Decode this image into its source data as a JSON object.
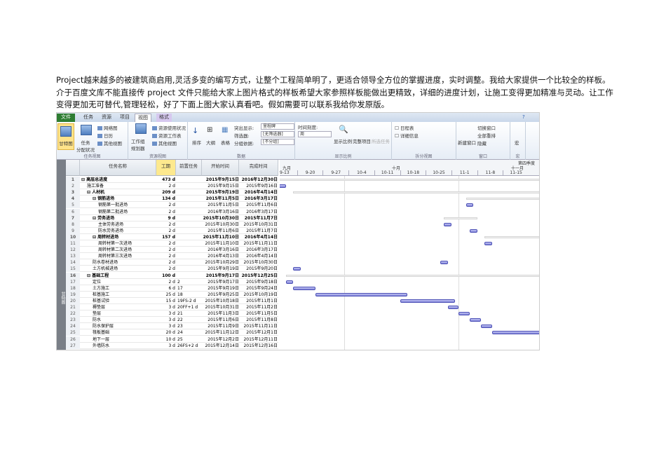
{
  "intro": "Project越来越多的被建筑商启用,灵活多变的编写方式，让整个工程简单明了，更适合领导全方位的掌握进度，实时调整。我给大家提供一个比较全的样板。介于百度文库不能直接传 project 文件只能给大家上图片格式的样板希望大家参照样板能做出更精致，详细的进度计划，让施工变得更加精准与灵动。让工作变得更加无可替代,管理轻松，好了下面上图大家认真看吧。假如需要可以联系我给你发原版。",
  "tabs": [
    "文件",
    "任务",
    "资源",
    "项目",
    "视图",
    "格式"
  ],
  "ribbon": {
    "task_view": {
      "gantt": "甘特图",
      "assign": "任务",
      "assign2": "分配状况",
      "network": "网络图",
      "calendar": "日历",
      "other": "其他视图",
      "label": "任务视图"
    },
    "res_view": {
      "planner": "工作组",
      "planner2": "规划器",
      "usage": "资源使用状况",
      "sheet": "资源工作表",
      "other": "其他视图",
      "label": "资源视图"
    },
    "data": {
      "sort": "排序",
      "outline": "大纲",
      "tables": "表格",
      "highlight": "突出显示:",
      "highlight_val": "里程碑",
      "filter": "筛选器:",
      "filter_val": "[无筛选器]",
      "group": "分组依据:",
      "group_val": "[不分组]",
      "label": "数据"
    },
    "zoom": {
      "timescale": "时间刻度:",
      "timescale_val": "周",
      "zoom": "显示比例",
      "entire": "完整项目",
      "selected": "所选任务",
      "label": "显示比例"
    },
    "split": {
      "timeline": "日程表",
      "details": "详细信息",
      "label": "拆分视图"
    },
    "window": {
      "new": "新建窗口",
      "switch": "切换窗口",
      "arrange": "全部重排",
      "hide": "隐藏",
      "label": "窗口"
    },
    "macro": {
      "macro": "宏",
      "label": "宏"
    }
  },
  "side_label": "甘特图",
  "columns": [
    "任务名称",
    "工期",
    "前置任务",
    "开始时间",
    "完成时间"
  ],
  "timescale": {
    "q1": "九月",
    "q2": "十月",
    "q3": "十一月",
    "quarter": "第四季度",
    "weeks": [
      "9-13",
      "9-20",
      "9-27",
      "10-4",
      "10-11",
      "10-18",
      "10-25",
      "11-1",
      "11-8",
      "11-15"
    ]
  },
  "rows": [
    {
      "id": "1",
      "name": "高层总进度",
      "dur": "473 d",
      "pred": "",
      "start": "2015年9月15日",
      "finish": "2016年12月30日"
    },
    {
      "id": "2",
      "name": "施工准备",
      "dur": "2 d",
      "pred": "",
      "start": "2015年9月15日",
      "finish": "2015年9月16日"
    },
    {
      "id": "3",
      "name": "人材机",
      "dur": "209 d",
      "pred": "",
      "start": "2015年9月19日",
      "finish": "2016年4月14日"
    },
    {
      "id": "4",
      "name": "钢筋进场",
      "dur": "134 d",
      "pred": "",
      "start": "2015年11月5日",
      "finish": "2016年3月17日"
    },
    {
      "id": "5",
      "name": "钢筋第一批进场",
      "dur": "2 d",
      "pred": "",
      "start": "2015年11月5日",
      "finish": "2015年11月6日"
    },
    {
      "id": "6",
      "name": "钢筋第二批进场",
      "dur": "2 d",
      "pred": "",
      "start": "2016年3月16日",
      "finish": "2016年3月17日"
    },
    {
      "id": "7",
      "name": "劳务进场",
      "dur": "9 d",
      "pred": "",
      "start": "2015年10月30日",
      "finish": "2015年11月7日"
    },
    {
      "id": "8",
      "name": "主体劳务进场",
      "dur": "2 d",
      "pred": "",
      "start": "2015年10月30日",
      "finish": "2015年10月31日"
    },
    {
      "id": "9",
      "name": "防水劳务进场",
      "dur": "2 d",
      "pred": "",
      "start": "2015年11月6日",
      "finish": "2015年11月7日"
    },
    {
      "id": "10",
      "name": "周转材进场",
      "dur": "157 d",
      "pred": "",
      "start": "2015年11月10日",
      "finish": "2016年4月14日"
    },
    {
      "id": "11",
      "name": "周转材第一次进场",
      "dur": "2 d",
      "pred": "",
      "start": "2015年11月10日",
      "finish": "2015年11月11日"
    },
    {
      "id": "12",
      "name": "周转材第二次进场",
      "dur": "2 d",
      "pred": "",
      "start": "2016年3月16日",
      "finish": "2016年3月17日"
    },
    {
      "id": "13",
      "name": "周转材第三次进场",
      "dur": "2 d",
      "pred": "",
      "start": "2016年4月13日",
      "finish": "2016年4月14日"
    },
    {
      "id": "14",
      "name": "防水卷材进场",
      "dur": "2 d",
      "pred": "",
      "start": "2015年10月29日",
      "finish": "2015年10月30日"
    },
    {
      "id": "15",
      "name": "土方机械进场",
      "dur": "2 d",
      "pred": "",
      "start": "2015年9月19日",
      "finish": "2015年9月20日"
    },
    {
      "id": "16",
      "name": "基础工程",
      "dur": "100 d",
      "pred": "",
      "start": "2015年9月17日",
      "finish": "2015年12月25日"
    },
    {
      "id": "17",
      "name": "定位",
      "dur": "2 d",
      "pred": "2",
      "start": "2015年9月17日",
      "finish": "2015年9月18日"
    },
    {
      "id": "18",
      "name": "土方施工",
      "dur": "6 d",
      "pred": "17",
      "start": "2015年9月19日",
      "finish": "2015年9月24日"
    },
    {
      "id": "19",
      "name": "桩基施工",
      "dur": "25 d",
      "pred": "18",
      "start": "2015年9月25日",
      "finish": "2015年10月19日"
    },
    {
      "id": "20",
      "name": "桩基试验",
      "dur": "15 d",
      "pred": "19FS-2 d",
      "start": "2015年10月18日",
      "finish": "2015年11月1日"
    },
    {
      "id": "21",
      "name": "褥垫层",
      "dur": "3 d",
      "pred": "20FF+1 d",
      "start": "2015年10月31日",
      "finish": "2015年11月2日"
    },
    {
      "id": "22",
      "name": "垫层",
      "dur": "3 d",
      "pred": "21",
      "start": "2015年11月3日",
      "finish": "2015年11月5日"
    },
    {
      "id": "23",
      "name": "防水",
      "dur": "3 d",
      "pred": "22",
      "start": "2015年11月6日",
      "finish": "2015年11月8日"
    },
    {
      "id": "24",
      "name": "防水保护层",
      "dur": "3 d",
      "pred": "23",
      "start": "2015年11月9日",
      "finish": "2015年11月11日"
    },
    {
      "id": "25",
      "name": "筏板基础",
      "dur": "20 d",
      "pred": "24",
      "start": "2015年11月12日",
      "finish": "2015年12月1日"
    },
    {
      "id": "26",
      "name": "地下一层",
      "dur": "10 d",
      "pred": "25",
      "start": "2015年12月2日",
      "finish": "2015年12月11日"
    },
    {
      "id": "27",
      "name": "外墙防水",
      "dur": "3 d",
      "pred": "26FS+2 d",
      "start": "2015年12月14日",
      "finish": "2015年12月16日"
    }
  ],
  "summary_rows": [
    "1",
    "3",
    "4",
    "7",
    "10",
    "16"
  ],
  "levels": [
    0,
    1,
    1,
    2,
    3,
    3,
    2,
    3,
    3,
    2,
    3,
    3,
    3,
    2,
    2,
    1,
    2,
    2,
    2,
    2,
    2,
    2,
    2,
    2,
    2,
    2,
    2
  ]
}
